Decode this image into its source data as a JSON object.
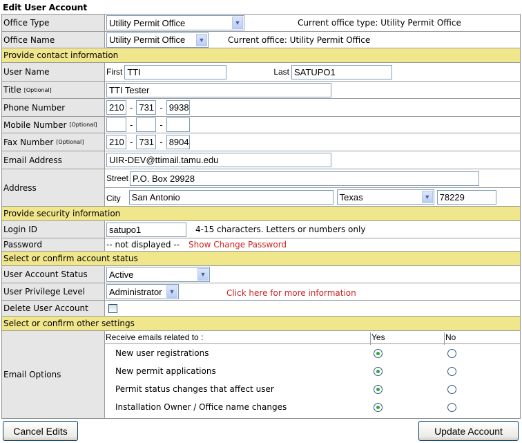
{
  "page": {
    "title": "Edit User Account"
  },
  "office": {
    "type_label": "Office Type",
    "type_value": "Utility Permit Office",
    "type_current": "Current office type: Utility Permit Office",
    "name_label": "Office Name",
    "name_value": "Utility Permit Office",
    "name_current": "Current office: Utility Permit Office"
  },
  "sections": {
    "contact": "Provide contact information",
    "security": "Provide security information",
    "status": "Select or confirm account status",
    "other": "Select or confirm other settings"
  },
  "contact": {
    "user_name_label": "User Name",
    "first_label": "First",
    "first_value": "TTI",
    "last_label": "Last",
    "last_value": "SATUPO1",
    "title_label": "Title",
    "optional": "[Optional]",
    "title_value": "TTI Tester",
    "phone_label": "Phone Number",
    "phone": [
      "210",
      "731",
      "9938"
    ],
    "mobile_label": "Mobile Number",
    "mobile": [
      "",
      "",
      ""
    ],
    "fax_label": "Fax Number",
    "fax": [
      "210",
      "731",
      "8904"
    ],
    "dash": "-",
    "email_label": "Email Address",
    "email_value": "UIR-DEV@ttimail.tamu.edu",
    "address_label": "Address",
    "street_label": "Street",
    "street_value": "P.O. Box 29928",
    "city_label": "City",
    "city_value": "San Antonio",
    "state_value": "Texas",
    "zip_value": "78229"
  },
  "security": {
    "login_label": "Login ID",
    "login_value": "satupo1",
    "login_hint": "4-15 characters. Letters or numbers only",
    "password_label": "Password",
    "password_value": "-- not displayed --",
    "password_link": "Show Change Password"
  },
  "status": {
    "account_status_label": "User Account Status",
    "account_status_value": "Active",
    "privilege_label": "User Privilege Level",
    "privilege_value": "Administrator",
    "privilege_link": "Click here for more information",
    "delete_label": "Delete User Account",
    "delete_checked": false
  },
  "email_options": {
    "label": "Email Options",
    "header": "Receive emails related to :",
    "yes": "Yes",
    "no": "No",
    "items": [
      {
        "label": "New user registrations",
        "selected": "yes"
      },
      {
        "label": "New permit applications",
        "selected": "yes"
      },
      {
        "label": "Permit status changes that affect user",
        "selected": "yes"
      },
      {
        "label": "Installation Owner / Office name changes",
        "selected": "yes"
      }
    ]
  },
  "buttons": {
    "cancel": "Cancel Edits",
    "update": "Update Account"
  }
}
